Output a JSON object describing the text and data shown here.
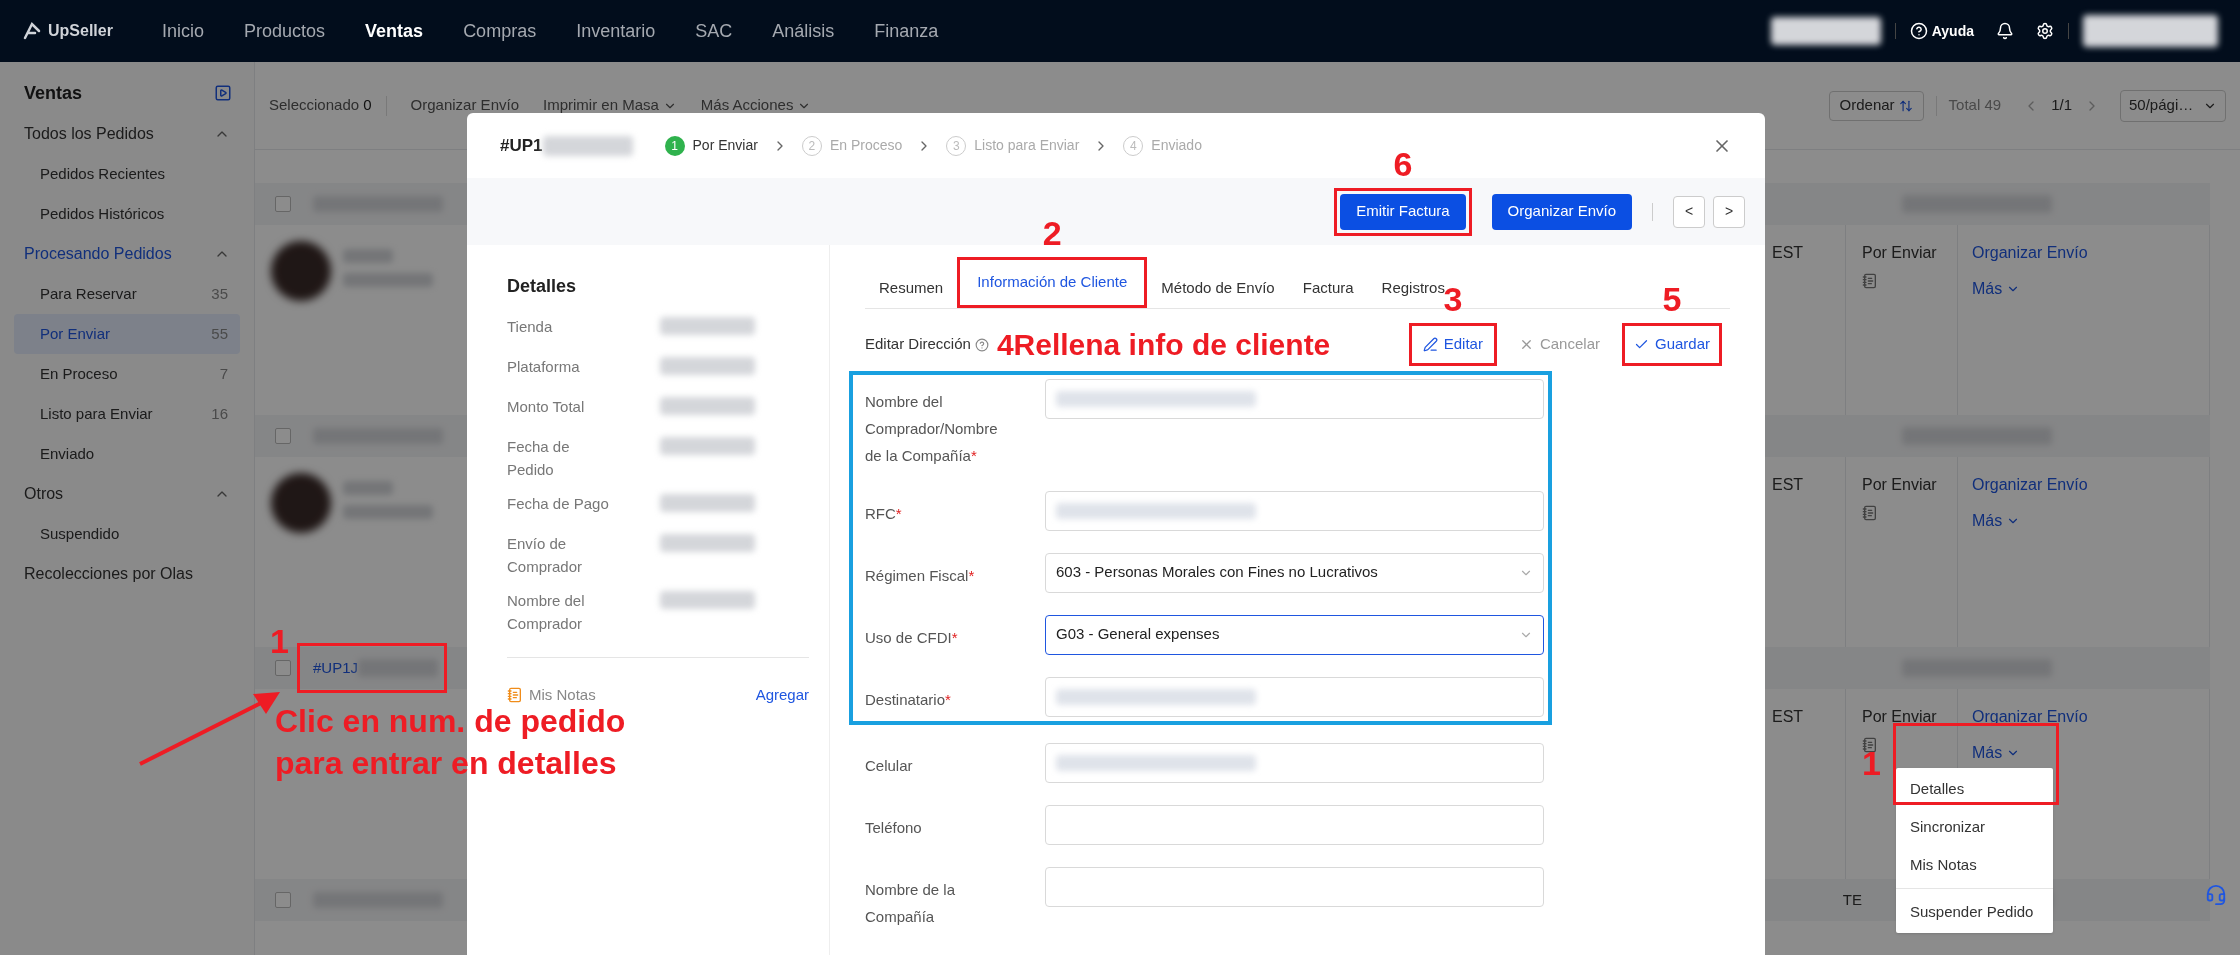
{
  "nav": {
    "logo": "UpSeller",
    "items": [
      {
        "label": "Inicio",
        "selected": false
      },
      {
        "label": "Productos",
        "selected": false
      },
      {
        "label": "Ventas",
        "selected": true
      },
      {
        "label": "Compras",
        "selected": false
      },
      {
        "label": "Inventario",
        "selected": false
      },
      {
        "label": "SAC",
        "selected": false
      },
      {
        "label": "Análisis",
        "selected": false
      },
      {
        "label": "Finanza",
        "selected": false
      }
    ],
    "help": "Ayuda"
  },
  "sidebar": {
    "title": "Ventas",
    "groups": [
      {
        "label": "Todos los Pedidos",
        "expanded": true,
        "selected": false,
        "children": [
          {
            "label": "Pedidos Recientes",
            "selected": false
          },
          {
            "label": "Pedidos Históricos",
            "selected": false
          }
        ]
      },
      {
        "label": "Procesando Pedidos",
        "expanded": true,
        "selected": true,
        "children": [
          {
            "label": "Para Reservar",
            "count": "35",
            "selected": false
          },
          {
            "label": "Por Enviar",
            "count": "55",
            "selected": true
          },
          {
            "label": "En Proceso",
            "count": "7",
            "selected": false
          },
          {
            "label": "Listo para Enviar",
            "count": "16",
            "selected": false
          },
          {
            "label": "Enviado",
            "selected": false
          }
        ]
      },
      {
        "label": "Otros",
        "expanded": true,
        "selected": false,
        "children": [
          {
            "label": "Suspendido",
            "selected": false
          }
        ]
      },
      {
        "label": "Recolecciones por Olas",
        "selected": false
      }
    ]
  },
  "toolbar": {
    "selected_label": "Seleccionado",
    "selected_count": "0",
    "actions": [
      {
        "label": "Organizar Envío",
        "kind": "button"
      },
      {
        "label": "Imprimir en Masa",
        "kind": "dropdown"
      },
      {
        "label": "Más Acciones",
        "kind": "dropdown"
      }
    ],
    "sort": "Ordenar",
    "total": "Total 49",
    "page": "1/1",
    "page_size": "50/pági…"
  },
  "orders": [
    {
      "checked": false,
      "column_3": "EST",
      "status": "Por Enviar",
      "action": "Organizar Envío",
      "more": "Más"
    },
    {
      "checked": false,
      "column_3": "EST",
      "status": "Por Enviar",
      "action": "Organizar Envío",
      "more": "Más"
    },
    {
      "checked": false,
      "order_link": {
        "text": "#UP1J",
        "callout": "1",
        "note_lines": [
          "Clic en num. de pedido",
          "para entrar en detalles"
        ]
      },
      "column_3": "EST",
      "status": "Por Enviar",
      "action": "Organizar Envío",
      "more": "Más",
      "more_menu": {
        "callout": "1",
        "items": [
          {
            "label": "Detalles",
            "divider_before": false
          },
          {
            "label": "Sincronizar",
            "divider_before": false
          },
          {
            "label": "Mis Notas",
            "divider_before": false
          },
          {
            "label": "Suspender Pedido",
            "divider_before": true
          }
        ]
      }
    },
    {
      "checked": false,
      "header_text": "TE"
    }
  ],
  "modal": {
    "order_id": "#UP1",
    "steps": [
      {
        "number": "1",
        "label": "Por Enviar",
        "selected": true
      },
      {
        "number": "2",
        "label": "En Proceso",
        "selected": false
      },
      {
        "number": "3",
        "label": "Listo para Enviar",
        "selected": false
      },
      {
        "number": "4",
        "label": "Enviado",
        "selected": false
      }
    ],
    "actions": [
      {
        "label": "Emitir Factura",
        "callout": "6"
      },
      {
        "label": "Organizar Envío"
      }
    ],
    "pager": [
      "<",
      ">"
    ],
    "details": {
      "title": "Detalles",
      "fields": [
        "Tienda",
        "Plataforma",
        "Monto Total",
        "Fecha de Pedido",
        "Fecha de Pago",
        "Envío de Comprador",
        "Nombre del Comprador"
      ],
      "notes": "Mis Notas",
      "add": "Agregar"
    },
    "tabs": [
      {
        "label": "Resumen",
        "selected": false
      },
      {
        "label": "Información de Cliente",
        "selected": true,
        "callout": "2"
      },
      {
        "label": "Método de Envío",
        "selected": false
      },
      {
        "label": "Factura",
        "selected": false
      },
      {
        "label": "Registros",
        "selected": false
      }
    ],
    "address": {
      "title": "Editar Dirección",
      "callout": {
        "number": "4",
        "text": "Rellena info de cliente"
      },
      "edit": {
        "label": "Editar",
        "callout": "3"
      },
      "cancel": {
        "label": "Cancelar"
      },
      "save": {
        "label": "Guardar",
        "callout": "5"
      }
    },
    "highlighted_fields": [
      {
        "label": "Nombre del Comprador/Nombre de la Compañía",
        "required_mark": "*",
        "kind": "input",
        "redacted": true
      },
      {
        "label": "RFC",
        "required_mark": "*",
        "kind": "input",
        "redacted": true
      },
      {
        "label": "Régimen Fiscal",
        "required_mark": "*",
        "kind": "select",
        "value": "603 - Personas Morales con Fines no Lucrativos",
        "focused": false
      },
      {
        "label": "Uso de CFDI",
        "required_mark": "*",
        "kind": "select",
        "value": "G03 - General expenses",
        "focused": true
      },
      {
        "label": "Destinatario",
        "required_mark": "*",
        "kind": "input",
        "redacted": true
      }
    ],
    "fields": [
      {
        "label": "Celular",
        "kind": "input",
        "redacted": true
      },
      {
        "label": "Teléfono",
        "kind": "input",
        "redacted": false
      },
      {
        "label": "Nombre de la Compañía",
        "kind": "input",
        "redacted": false
      }
    ]
  }
}
